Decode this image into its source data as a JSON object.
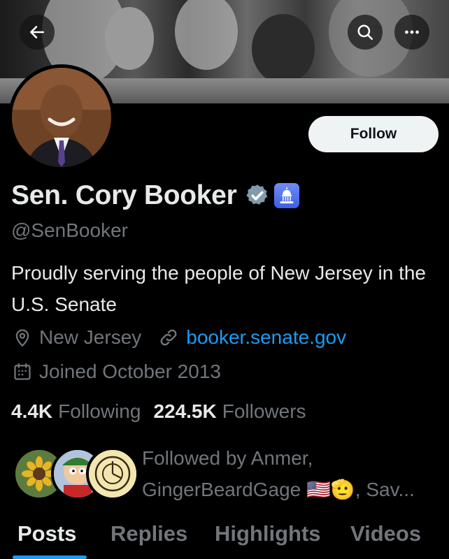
{
  "header": {
    "back_icon": "arrow-left-icon",
    "search_icon": "search-icon",
    "more_icon": "more-horizontal-icon"
  },
  "profile": {
    "name": "Sen. Cory Booker",
    "handle": "@SenBooker",
    "follow_label": "Follow",
    "bio": "Proudly serving the people of New Jersey in the U.S. Senate",
    "location": "New Jersey",
    "website": "booker.senate.gov",
    "joined": "Joined October 2013",
    "following_count": "4.4K",
    "following_label": "Following",
    "followers_count": "224.5K",
    "followers_label": "Followers",
    "followed_by": "Followed by Anmer, GingerBeardGage 🇺🇸🫡, Sav..."
  },
  "tabs": [
    {
      "label": "Posts",
      "active": true
    },
    {
      "label": "Replies",
      "active": false
    },
    {
      "label": "Highlights",
      "active": false
    },
    {
      "label": "Videos",
      "active": false
    }
  ],
  "colors": {
    "accent": "#1d9bf0",
    "background": "#000000",
    "text": "#e7e9ea",
    "muted": "#71767b"
  }
}
